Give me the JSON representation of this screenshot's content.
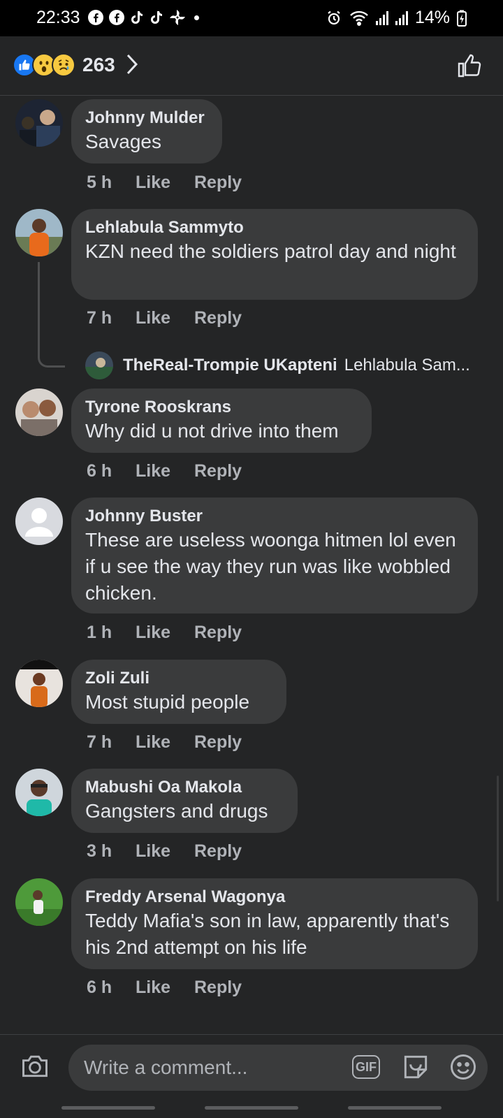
{
  "status_bar": {
    "time": "22:33",
    "battery": "14%",
    "app_icons": [
      "facebook-icon",
      "facebook-icon",
      "tiktok-icon",
      "tiktok-icon",
      "pinwheel-icon"
    ]
  },
  "header": {
    "reactions": [
      "like",
      "wow",
      "sad"
    ],
    "reaction_count": "263"
  },
  "colors": {
    "background": "#242526",
    "bubble": "#3a3b3c",
    "like_blue": "#1877f2",
    "secondary_text": "#b0b3b8"
  },
  "comments": [
    {
      "author": "Johnny Mulder",
      "text": "Savages",
      "time": "5 h",
      "like": "Like",
      "reply": "Reply"
    },
    {
      "author": "Lehlabula Sammyto",
      "text": "KZN need the soldiers patrol day and night",
      "time": "7 h",
      "like": "Like",
      "reply": "Reply"
    },
    {
      "author": "Tyrone Rooskrans",
      "text": "Why did u not drive into them",
      "time": "6 h",
      "like": "Like",
      "reply": "Reply"
    },
    {
      "author": "Johnny Buster",
      "text": "These are useless woonga hitmen lol even if u see the way they run was  like wobbled chicken.",
      "time": "1 h",
      "like": "Like",
      "reply": "Reply"
    },
    {
      "author": "Zoli Zuli",
      "text": "Most stupid people",
      "time": "7 h",
      "like": "Like",
      "reply": "Reply"
    },
    {
      "author": "Mabushi Oa Makola",
      "text": "Gangsters and drugs",
      "time": "3 h",
      "like": "Like",
      "reply": "Reply"
    },
    {
      "author": "Freddy Arsenal Wagonya",
      "text": "Teddy Mafia's son in law, apparently that's his 2nd attempt on his life",
      "time": "6 h",
      "like": "Like",
      "reply": "Reply"
    }
  ],
  "reply_preview": {
    "author": "TheReal-Trompie UKapteni",
    "snippet": "Lehlabula Sam..."
  },
  "composer": {
    "placeholder": "Write a comment...",
    "gif_label": "GIF"
  }
}
